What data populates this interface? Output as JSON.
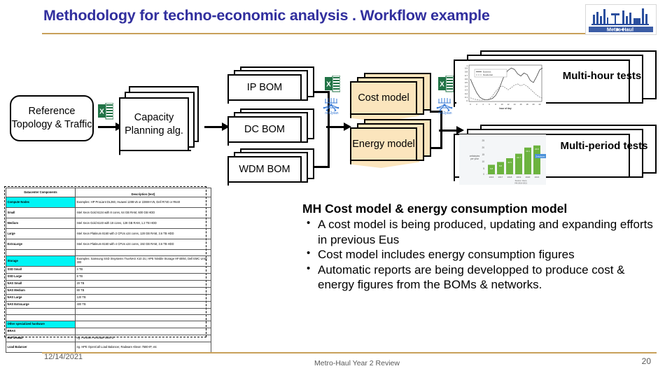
{
  "slide": {
    "title": "Methodology for techno-economic analysis . Workflow example",
    "accent_color": "#312f9e",
    "rule_color": "#c8a05a"
  },
  "logo": {
    "name": "metro-haul-logo",
    "text": "Metro  Haul",
    "color": "#2b4f9e"
  },
  "workflow": {
    "input_box": "Reference Topology & Traffic",
    "capacity_box": "Capacity Planning alg.",
    "boms": [
      "IP BOM",
      "DC BOM",
      "WDM BOM"
    ],
    "models": [
      "Cost model",
      "Energy model"
    ],
    "results": [
      "Multi-hour tests",
      "Multi-period tests"
    ],
    "icons": {
      "excel": "excel-icon",
      "net2plan": "net2plan-icon",
      "arrow": "arrow-right-icon"
    }
  },
  "chart_data": [
    {
      "type": "line",
      "title": "",
      "xlabel": "hour of day",
      "ylabel": "normalized traffic",
      "x": [
        0,
        1,
        2,
        3,
        4,
        5,
        6,
        7,
        8,
        9,
        10,
        11,
        12,
        13,
        14,
        15,
        16,
        17,
        18,
        19,
        20,
        21,
        22,
        23
      ],
      "ylim": [
        0,
        1
      ],
      "xlim": [
        0,
        23
      ],
      "grid": false,
      "legend_position": "upper-left",
      "series": [
        {
          "name": "Residential",
          "values": [
            0.62,
            0.42,
            0.24,
            0.13,
            0.08,
            0.06,
            0.07,
            0.1,
            0.18,
            0.33,
            0.55,
            0.74,
            0.86,
            0.92,
            0.88,
            0.76,
            0.7,
            0.78,
            0.72,
            0.56,
            0.5,
            0.66,
            0.85,
            0.9
          ]
        },
        {
          "name": "Business",
          "values": [
            0.1,
            0.07,
            0.05,
            0.04,
            0.04,
            0.05,
            0.08,
            0.16,
            0.28,
            0.38,
            0.44,
            0.4,
            0.33,
            0.38,
            0.45,
            0.48,
            0.44,
            0.47,
            0.42,
            0.34,
            0.26,
            0.18,
            0.12,
            0.09
          ]
        }
      ]
    },
    {
      "type": "bar",
      "title": "",
      "xlabel": "Source: Cisco VNI 2016-2021",
      "ylabel": "zettabytes per year",
      "categories": [
        "2016",
        "2017",
        "2018",
        "2019",
        "2020",
        "2021"
      ],
      "values": [
        6.8,
        8.8,
        11.5,
        14.7,
        19.1,
        20.6
      ],
      "ylim": [
        0,
        25
      ],
      "grid": false,
      "bar_color": "#6cb33f",
      "annotation": "Zettabytes"
    }
  ],
  "datacenter_table": {
    "headers": [
      "Datacenter Components",
      "Description (text)"
    ],
    "rows": [
      {
        "highlight": true,
        "name": "Compute Nodes",
        "desc": "Examples: HP ProLiant DL360, Huawei 1288-v5 or 2288H-V5, Dell R740 or R640"
      },
      {
        "highlight": false,
        "name": "Small",
        "desc": "Intel Xeon Gold 6134 with 8 cores, 64 GB RAM, 600 GB HDD"
      },
      {
        "highlight": false,
        "name": "Medium",
        "desc": "Intel Xeon Gold 6140 with 18 cores, 128 GB RAM, 1.2 TB HDD"
      },
      {
        "highlight": false,
        "name": "Large",
        "desc": "Intel Xeon Platinum 8160 with 2 CPUs x24 cores, 128 GB RAM, 3.6 TB HDD"
      },
      {
        "highlight": false,
        "name": "ExtraLarge",
        "desc": "Intel Xeon Platinum 8160 with 4 CPUs x24 cores, 192 GB RAM, 3.6 TB HDD"
      },
      {
        "highlight": false,
        "name": "",
        "desc": ""
      },
      {
        "highlight": true,
        "name": "Storage",
        "desc": "Examples: Samsung SSD iXsystems TrueNAS X10 2U, HPE Nimble Storage HF40/60, Dell EMC Unity 300"
      },
      {
        "highlight": false,
        "name": "SSD Small",
        "desc": "4 TB"
      },
      {
        "highlight": false,
        "name": "SSD Large",
        "desc": "8 TB"
      },
      {
        "highlight": false,
        "name": "NAS Small",
        "desc": "20 TB"
      },
      {
        "highlight": false,
        "name": "NAS Medium",
        "desc": "80 TB"
      },
      {
        "highlight": false,
        "name": "NAS Large",
        "desc": "120 TB"
      },
      {
        "highlight": false,
        "name": "NAS ExtraLarge",
        "desc": "400 TB"
      },
      {
        "highlight": false,
        "name": "",
        "desc": ""
      },
      {
        "highlight": false,
        "name": "",
        "desc": ""
      },
      {
        "highlight": true,
        "name": "Other specialized hardware",
        "desc": ""
      },
      {
        "highlight": false,
        "name": "BRAS",
        "desc": ""
      },
      {
        "highlight": false,
        "name": "HW firewall",
        "desc": "eg. Fortinet FortiGate 3000 D"
      },
      {
        "highlight": false,
        "name": "Load Balancer",
        "desc": "eg. HPE OpenCall Load Balancer, Radware Alteon 7580-IP, etc"
      }
    ],
    "highlight_color": "#00f5f5"
  },
  "body": {
    "heading": "MH Cost model & energy consumption model",
    "bullets": [
      "A cost model is being produced, updating and expanding efforts in previous Eus",
      "Cost model includes energy consumption figures",
      "Automatic reports are being developped to produce cost & energy figures from the BOMs & networks."
    ]
  },
  "footer": {
    "date": "12/14/2021",
    "center": "Metro-Haul Year 2 Review",
    "page": "20"
  }
}
